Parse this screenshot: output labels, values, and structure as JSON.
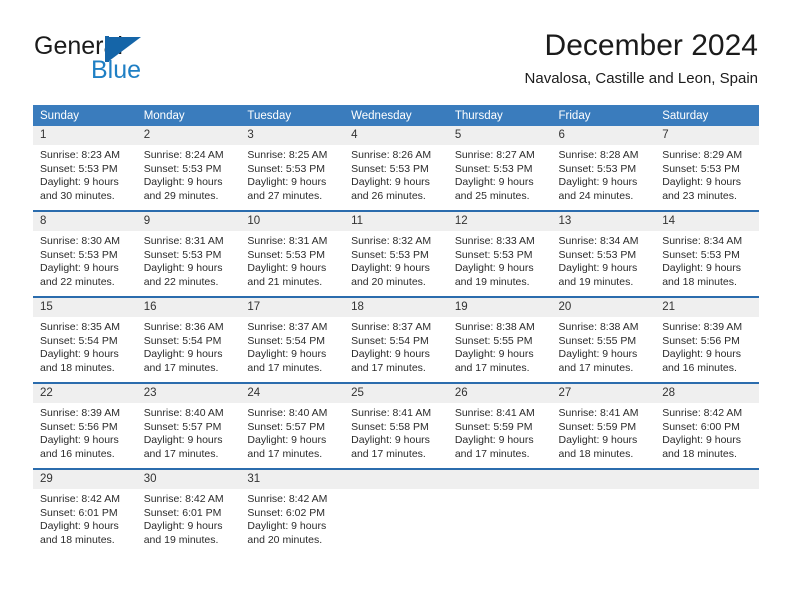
{
  "brand": {
    "name_part1": "General",
    "name_part2": "Blue",
    "mark_icon": "triangle-flag-icon",
    "accent_color": "#1565a8"
  },
  "header": {
    "title": "December 2024",
    "subtitle": "Navalosa, Castille and Leon, Spain"
  },
  "colors": {
    "header_row_bg": "#3a7cbd",
    "row_separator": "#2b6cad",
    "daynum_bg": "#efefef",
    "brand_blue": "#1f7fc4"
  },
  "weekday_headers": [
    "Sunday",
    "Monday",
    "Tuesday",
    "Wednesday",
    "Thursday",
    "Friday",
    "Saturday"
  ],
  "weeks": [
    [
      {
        "day": "1",
        "sunrise": "Sunrise: 8:23 AM",
        "sunset": "Sunset: 5:53 PM",
        "daylight_line1": "Daylight: 9 hours",
        "daylight_line2": "and 30 minutes."
      },
      {
        "day": "2",
        "sunrise": "Sunrise: 8:24 AM",
        "sunset": "Sunset: 5:53 PM",
        "daylight_line1": "Daylight: 9 hours",
        "daylight_line2": "and 29 minutes."
      },
      {
        "day": "3",
        "sunrise": "Sunrise: 8:25 AM",
        "sunset": "Sunset: 5:53 PM",
        "daylight_line1": "Daylight: 9 hours",
        "daylight_line2": "and 27 minutes."
      },
      {
        "day": "4",
        "sunrise": "Sunrise: 8:26 AM",
        "sunset": "Sunset: 5:53 PM",
        "daylight_line1": "Daylight: 9 hours",
        "daylight_line2": "and 26 minutes."
      },
      {
        "day": "5",
        "sunrise": "Sunrise: 8:27 AM",
        "sunset": "Sunset: 5:53 PM",
        "daylight_line1": "Daylight: 9 hours",
        "daylight_line2": "and 25 minutes."
      },
      {
        "day": "6",
        "sunrise": "Sunrise: 8:28 AM",
        "sunset": "Sunset: 5:53 PM",
        "daylight_line1": "Daylight: 9 hours",
        "daylight_line2": "and 24 minutes."
      },
      {
        "day": "7",
        "sunrise": "Sunrise: 8:29 AM",
        "sunset": "Sunset: 5:53 PM",
        "daylight_line1": "Daylight: 9 hours",
        "daylight_line2": "and 23 minutes."
      }
    ],
    [
      {
        "day": "8",
        "sunrise": "Sunrise: 8:30 AM",
        "sunset": "Sunset: 5:53 PM",
        "daylight_line1": "Daylight: 9 hours",
        "daylight_line2": "and 22 minutes."
      },
      {
        "day": "9",
        "sunrise": "Sunrise: 8:31 AM",
        "sunset": "Sunset: 5:53 PM",
        "daylight_line1": "Daylight: 9 hours",
        "daylight_line2": "and 22 minutes."
      },
      {
        "day": "10",
        "sunrise": "Sunrise: 8:31 AM",
        "sunset": "Sunset: 5:53 PM",
        "daylight_line1": "Daylight: 9 hours",
        "daylight_line2": "and 21 minutes."
      },
      {
        "day": "11",
        "sunrise": "Sunrise: 8:32 AM",
        "sunset": "Sunset: 5:53 PM",
        "daylight_line1": "Daylight: 9 hours",
        "daylight_line2": "and 20 minutes."
      },
      {
        "day": "12",
        "sunrise": "Sunrise: 8:33 AM",
        "sunset": "Sunset: 5:53 PM",
        "daylight_line1": "Daylight: 9 hours",
        "daylight_line2": "and 19 minutes."
      },
      {
        "day": "13",
        "sunrise": "Sunrise: 8:34 AM",
        "sunset": "Sunset: 5:53 PM",
        "daylight_line1": "Daylight: 9 hours",
        "daylight_line2": "and 19 minutes."
      },
      {
        "day": "14",
        "sunrise": "Sunrise: 8:34 AM",
        "sunset": "Sunset: 5:53 PM",
        "daylight_line1": "Daylight: 9 hours",
        "daylight_line2": "and 18 minutes."
      }
    ],
    [
      {
        "day": "15",
        "sunrise": "Sunrise: 8:35 AM",
        "sunset": "Sunset: 5:54 PM",
        "daylight_line1": "Daylight: 9 hours",
        "daylight_line2": "and 18 minutes."
      },
      {
        "day": "16",
        "sunrise": "Sunrise: 8:36 AM",
        "sunset": "Sunset: 5:54 PM",
        "daylight_line1": "Daylight: 9 hours",
        "daylight_line2": "and 17 minutes."
      },
      {
        "day": "17",
        "sunrise": "Sunrise: 8:37 AM",
        "sunset": "Sunset: 5:54 PM",
        "daylight_line1": "Daylight: 9 hours",
        "daylight_line2": "and 17 minutes."
      },
      {
        "day": "18",
        "sunrise": "Sunrise: 8:37 AM",
        "sunset": "Sunset: 5:54 PM",
        "daylight_line1": "Daylight: 9 hours",
        "daylight_line2": "and 17 minutes."
      },
      {
        "day": "19",
        "sunrise": "Sunrise: 8:38 AM",
        "sunset": "Sunset: 5:55 PM",
        "daylight_line1": "Daylight: 9 hours",
        "daylight_line2": "and 17 minutes."
      },
      {
        "day": "20",
        "sunrise": "Sunrise: 8:38 AM",
        "sunset": "Sunset: 5:55 PM",
        "daylight_line1": "Daylight: 9 hours",
        "daylight_line2": "and 17 minutes."
      },
      {
        "day": "21",
        "sunrise": "Sunrise: 8:39 AM",
        "sunset": "Sunset: 5:56 PM",
        "daylight_line1": "Daylight: 9 hours",
        "daylight_line2": "and 16 minutes."
      }
    ],
    [
      {
        "day": "22",
        "sunrise": "Sunrise: 8:39 AM",
        "sunset": "Sunset: 5:56 PM",
        "daylight_line1": "Daylight: 9 hours",
        "daylight_line2": "and 16 minutes."
      },
      {
        "day": "23",
        "sunrise": "Sunrise: 8:40 AM",
        "sunset": "Sunset: 5:57 PM",
        "daylight_line1": "Daylight: 9 hours",
        "daylight_line2": "and 17 minutes."
      },
      {
        "day": "24",
        "sunrise": "Sunrise: 8:40 AM",
        "sunset": "Sunset: 5:57 PM",
        "daylight_line1": "Daylight: 9 hours",
        "daylight_line2": "and 17 minutes."
      },
      {
        "day": "25",
        "sunrise": "Sunrise: 8:41 AM",
        "sunset": "Sunset: 5:58 PM",
        "daylight_line1": "Daylight: 9 hours",
        "daylight_line2": "and 17 minutes."
      },
      {
        "day": "26",
        "sunrise": "Sunrise: 8:41 AM",
        "sunset": "Sunset: 5:59 PM",
        "daylight_line1": "Daylight: 9 hours",
        "daylight_line2": "and 17 minutes."
      },
      {
        "day": "27",
        "sunrise": "Sunrise: 8:41 AM",
        "sunset": "Sunset: 5:59 PM",
        "daylight_line1": "Daylight: 9 hours",
        "daylight_line2": "and 18 minutes."
      },
      {
        "day": "28",
        "sunrise": "Sunrise: 8:42 AM",
        "sunset": "Sunset: 6:00 PM",
        "daylight_line1": "Daylight: 9 hours",
        "daylight_line2": "and 18 minutes."
      }
    ],
    [
      {
        "day": "29",
        "sunrise": "Sunrise: 8:42 AM",
        "sunset": "Sunset: 6:01 PM",
        "daylight_line1": "Daylight: 9 hours",
        "daylight_line2": "and 18 minutes."
      },
      {
        "day": "30",
        "sunrise": "Sunrise: 8:42 AM",
        "sunset": "Sunset: 6:01 PM",
        "daylight_line1": "Daylight: 9 hours",
        "daylight_line2": "and 19 minutes."
      },
      {
        "day": "31",
        "sunrise": "Sunrise: 8:42 AM",
        "sunset": "Sunset: 6:02 PM",
        "daylight_line1": "Daylight: 9 hours",
        "daylight_line2": "and 20 minutes."
      },
      {
        "day": "",
        "sunrise": "",
        "sunset": "",
        "daylight_line1": "",
        "daylight_line2": ""
      },
      {
        "day": "",
        "sunrise": "",
        "sunset": "",
        "daylight_line1": "",
        "daylight_line2": ""
      },
      {
        "day": "",
        "sunrise": "",
        "sunset": "",
        "daylight_line1": "",
        "daylight_line2": ""
      },
      {
        "day": "",
        "sunrise": "",
        "sunset": "",
        "daylight_line1": "",
        "daylight_line2": ""
      }
    ]
  ]
}
